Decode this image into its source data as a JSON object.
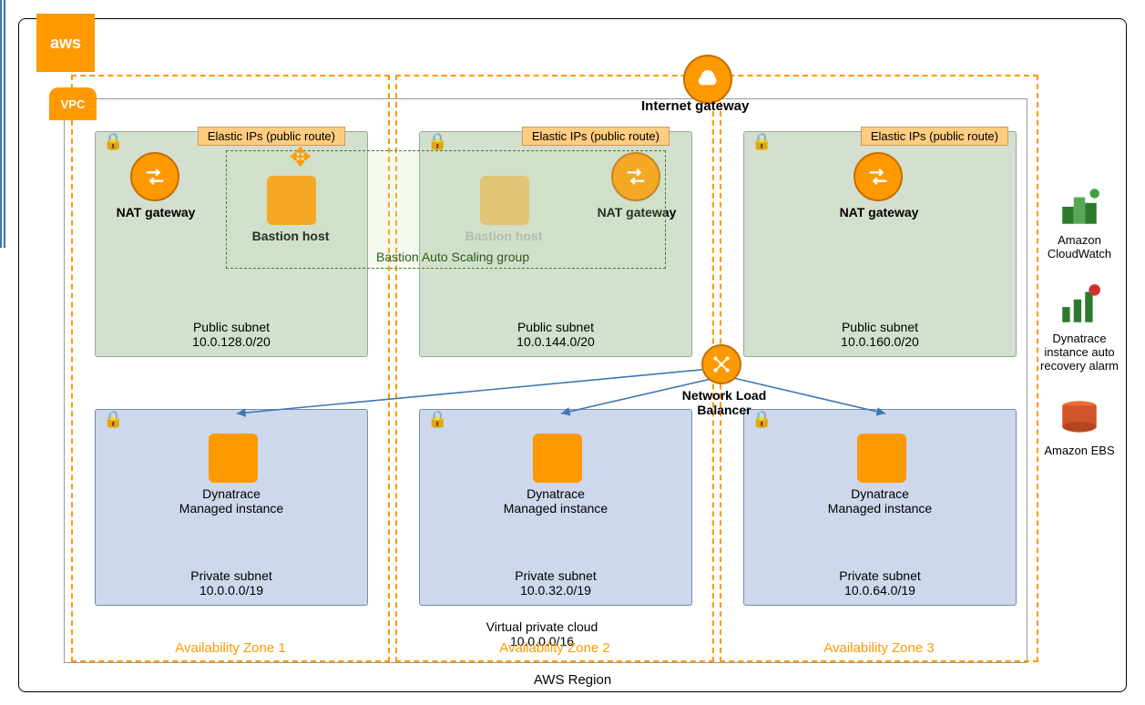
{
  "region": {
    "label": "AWS Region",
    "logo": "aws"
  },
  "vpc": {
    "badge": "VPC",
    "label1": "Virtual private cloud",
    "cidr": "10.0.0.0/16"
  },
  "igw": {
    "label": "Internet gateway"
  },
  "nlb": {
    "label": "Network Load Balancer"
  },
  "asg": {
    "label": "Bastion Auto Scaling group"
  },
  "az": [
    {
      "name": "Availability Zone 1",
      "public": {
        "eip": "Elastic IPs (public route)",
        "nat": "NAT gateway",
        "bastion": "Bastion host",
        "label": "Public subnet",
        "cidr": "10.0.128.0/20"
      },
      "private": {
        "dyn1": "Dynatrace",
        "dyn2": "Managed instance",
        "label": "Private subnet",
        "cidr": "10.0.0.0/19"
      }
    },
    {
      "name": "Availability Zone 2",
      "public": {
        "eip": "Elastic IPs (public route)",
        "nat": "NAT gateway",
        "bastion": "Bastion host",
        "label": "Public subnet",
        "cidr": "10.0.144.0/20"
      },
      "private": {
        "dyn1": "Dynatrace",
        "dyn2": "Managed instance",
        "label": "Private subnet",
        "cidr": "10.0.32.0/19"
      }
    },
    {
      "name": "Availability Zone 3",
      "public": {
        "eip": "Elastic IPs (public route)",
        "nat": "NAT gateway",
        "label": "Public subnet",
        "cidr": "10.0.160.0/20"
      },
      "private": {
        "dyn1": "Dynatrace",
        "dyn2": "Managed instance",
        "label": "Private subnet",
        "cidr": "10.0.64.0/19"
      }
    }
  ],
  "sidebar": {
    "cloudwatch": "Amazon CloudWatch",
    "alarm": "Dynatrace instance auto recovery alarm",
    "ebs": "Amazon EBS"
  }
}
